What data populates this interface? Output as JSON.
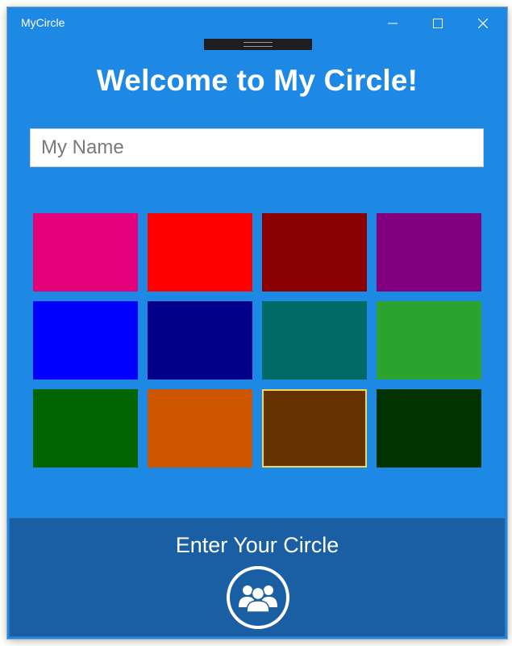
{
  "window": {
    "title": "MyCircle"
  },
  "main": {
    "heading": "Welcome to My Circle!",
    "name_placeholder": "My Name",
    "name_value": ""
  },
  "swatches": [
    {
      "color": "#e3007a",
      "selected": false
    },
    {
      "color": "#ff0000",
      "selected": false
    },
    {
      "color": "#8b0000",
      "selected": false
    },
    {
      "color": "#800080",
      "selected": false
    },
    {
      "color": "#0000ff",
      "selected": false
    },
    {
      "color": "#00008b",
      "selected": false
    },
    {
      "color": "#006a66",
      "selected": false
    },
    {
      "color": "#2ca32c",
      "selected": false
    },
    {
      "color": "#006400",
      "selected": false
    },
    {
      "color": "#cc5500",
      "selected": false
    },
    {
      "color": "#663300",
      "selected": true
    },
    {
      "color": "#003300",
      "selected": false
    }
  ],
  "footer": {
    "label": "Enter Your Circle",
    "icon": "group-icon"
  },
  "colors": {
    "background": "#1e88e5",
    "footer": "#1a5fa3",
    "selection_border": "#f2d94a"
  }
}
